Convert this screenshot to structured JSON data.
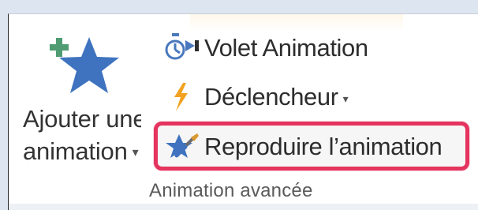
{
  "ribbon_group": {
    "label": "Animation avancée"
  },
  "add_animation": {
    "line1": "Ajouter une",
    "line2": "animation",
    "arrow": "▾",
    "icon": "star-plus-icon"
  },
  "commands": [
    {
      "label": "Volet Animation",
      "icon": "stopwatch-panel-icon",
      "has_dropdown": false
    },
    {
      "label": "Déclencheur",
      "icon": "lightning-icon",
      "has_dropdown": true,
      "dropdown_arrow": "▾"
    },
    {
      "label": "Reproduire l’animation",
      "icon": "star-paintbrush-icon",
      "has_dropdown": false
    }
  ],
  "colors": {
    "highlight": "#e4345f",
    "star_blue": "#3f73bf",
    "plus_green": "#4f9b72",
    "lightning_orange": "#f3a21f"
  }
}
